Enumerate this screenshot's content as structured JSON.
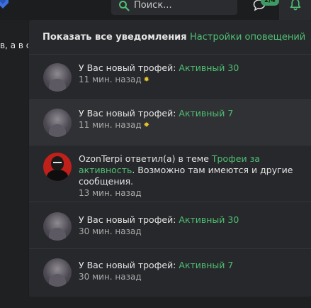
{
  "search": {
    "placeholder": "Поиск..."
  },
  "header": {
    "messages_badge": "2/4",
    "left_snippet": "в, а в с"
  },
  "notifications": {
    "show_all_label": "Показать все уведомления",
    "settings_label": "Настройки оповещений",
    "items": [
      {
        "prefix": "У Вас новый трофей: ",
        "link": "Активный 30",
        "suffix": "",
        "time": "11 мин. назад",
        "unread": true,
        "selected": false
      },
      {
        "prefix": "У Вас новый трофей: ",
        "link": "Активный 7",
        "suffix": "",
        "time": "11 мин. назад",
        "unread": true,
        "selected": true
      },
      {
        "prefix": "OzonTerpi ответил(а) в теме ",
        "link": "Трофеи за активность",
        "suffix": ". Возможно там имеются и другие сообщения.",
        "time": "13 мин. назад",
        "unread": false,
        "selected": false
      },
      {
        "prefix": "У Вас новый трофей: ",
        "link": "Активный 30",
        "suffix": "",
        "time": "30 мин. назад",
        "unread": false,
        "selected": false
      },
      {
        "prefix": "У Вас новый трофей: ",
        "link": "Активный 7",
        "suffix": "",
        "time": "30 мин. назад",
        "unread": false,
        "selected": false
      }
    ]
  },
  "icons": {
    "unread_marker": "✸"
  },
  "colors": {
    "accent": "#4fbf74",
    "badge": "#3f9a63",
    "star": "#e3c22f",
    "logo": "#3d6fe0"
  }
}
